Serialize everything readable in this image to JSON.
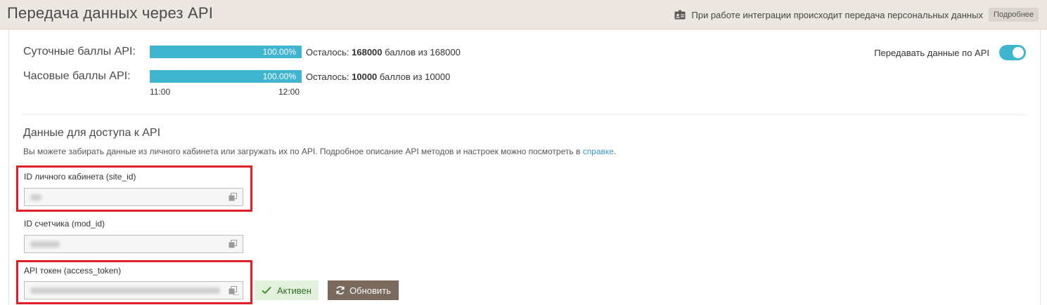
{
  "header": {
    "title": "Передача данных через API",
    "notice_text": "При работе интеграции происходит передача персональных данных",
    "more_label": "Подробнее"
  },
  "quotas": [
    {
      "label": "Суточные баллы API:",
      "percent_text": "100.00%",
      "fill_fraction": 1.0,
      "rest_prefix": "Осталось:",
      "rest_value": "168000",
      "rest_suffix": "баллов из 168000"
    },
    {
      "label": "Часовые баллы API:",
      "percent_text": "100.00%",
      "fill_fraction": 1.0,
      "rest_prefix": "Осталось:",
      "rest_value": "10000",
      "rest_suffix": "баллов из 10000"
    }
  ],
  "time_labels": {
    "start": "11:00",
    "end": "12:00"
  },
  "toggle": {
    "label": "Передавать данные по API",
    "state": "on"
  },
  "access": {
    "title": "Данные для доступа к API",
    "description": "Вы можете забирать данные из личного кабинета или загружать их по API. Подробное описание API методов и настроек можно посмотреть в",
    "link_text": "справке",
    "description_end": "."
  },
  "fields": [
    {
      "label": "ID личного кабинета (site_id)",
      "value_hidden": true
    },
    {
      "label": "ID счетчика (mod_id)",
      "value_hidden": true
    },
    {
      "label": "API токен (access_token)",
      "value_hidden": true,
      "ellipsis": "..."
    }
  ],
  "token_status": {
    "label": "Активен"
  },
  "refresh": {
    "label": "Обновить"
  },
  "colors": {
    "accent": "#3fb5cf",
    "header_bg": "#ede7e1",
    "highlight": "#e01e27",
    "status_bg": "#e2f1dc",
    "button_bg": "#7a6a5e",
    "link": "#3a9bc0"
  },
  "icons": {
    "notice": "id-card-icon",
    "copy": "copy-icon",
    "check": "check-icon",
    "refresh": "refresh-icon"
  }
}
